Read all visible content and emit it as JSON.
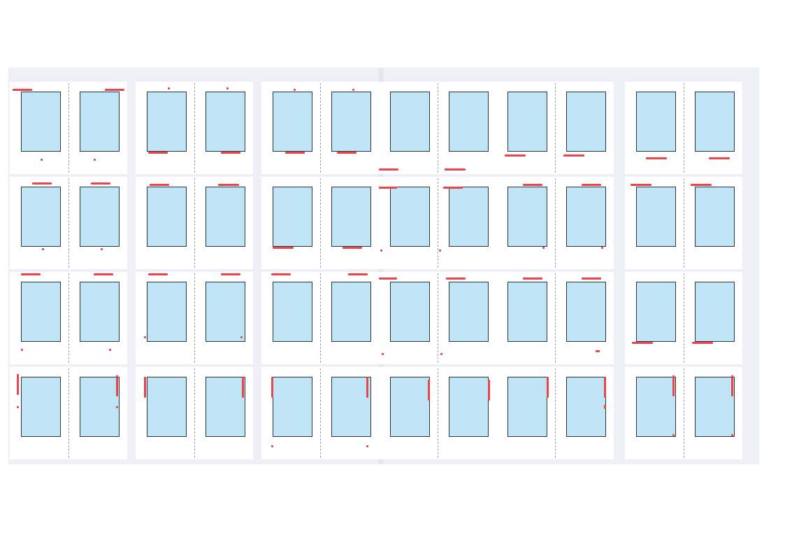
{
  "image": {
    "description_colors": {
      "page": "#eff0f7",
      "spread": "#ffffff",
      "text_block": "#bfe4f6",
      "marker": "#e9454b",
      "border": "#2a3540"
    },
    "rows": 4,
    "spreads_per_row": 6
  }
}
